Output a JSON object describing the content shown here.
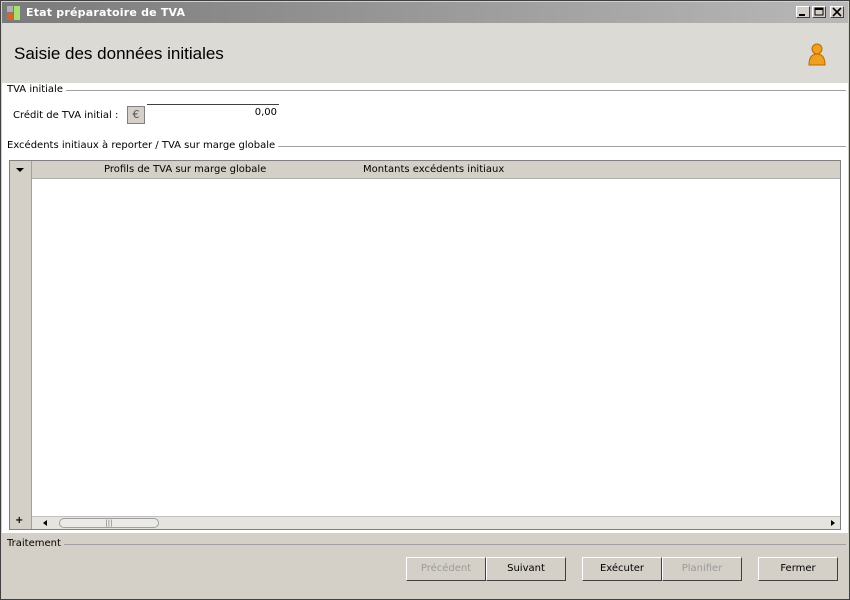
{
  "window": {
    "title": "Etat préparatoire de TVA"
  },
  "header": {
    "title": "Saisie des données initiales"
  },
  "tva_initiale": {
    "legend": "TVA initiale",
    "credit_label": "Crédit de TVA initial :",
    "currency_symbol": "€",
    "credit_value": "0,00"
  },
  "excedents": {
    "legend": "Excédents initiaux à reporter / TVA sur marge globale",
    "columns": [
      "Profils de TVA sur marge globale",
      "Montants excédents initiaux"
    ],
    "rows": [],
    "add_symbol": "+",
    "scroll_thumb_grip": "|||"
  },
  "traitement": {
    "legend": "Traitement",
    "buttons": {
      "precedent": "Précédent",
      "suivant": "Suivant",
      "executer": "Exécuter",
      "planifier": "Planifier",
      "fermer": "Fermer"
    }
  },
  "icons": {
    "app": "app-icon",
    "minimize": "minimize-icon",
    "maximize": "maximize-icon",
    "close": "close-icon",
    "user": "user-icon"
  },
  "colors": {
    "titlebar_start": "#7a7a7a",
    "titlebar_end": "#b8b8b8",
    "user_icon": "#f0a020",
    "disabled_text": "#9a9a9a"
  }
}
